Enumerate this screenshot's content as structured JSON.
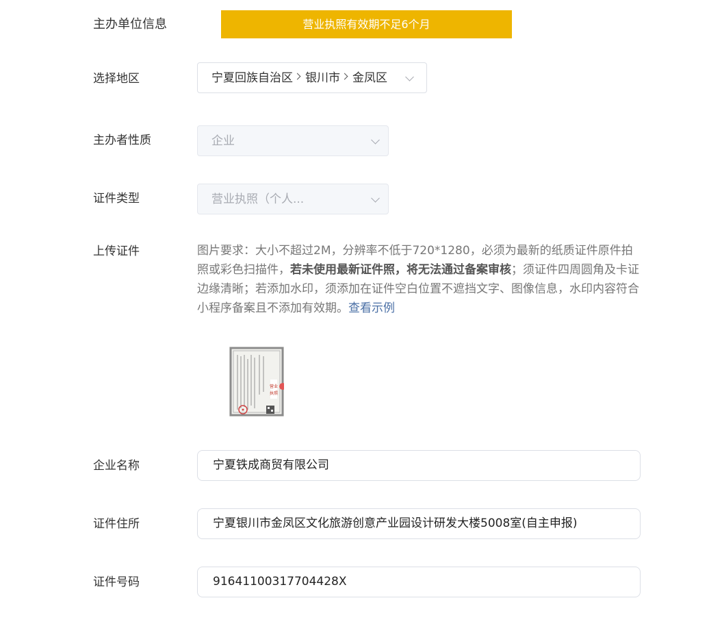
{
  "header": {
    "section_title": "主办单位信息",
    "warning_banner": "营业执照有效期不足6个月",
    "banner_color": "#EEB500"
  },
  "region": {
    "label": "选择地区",
    "parts": [
      "宁夏回族自治区",
      "银川市",
      "金凤区"
    ]
  },
  "organizer_type": {
    "label": "主办者性质",
    "value": "企业",
    "disabled": true
  },
  "certificate_type": {
    "label": "证件类型",
    "value": "营业执照（个人...",
    "disabled": true
  },
  "upload": {
    "label": "上传证件",
    "desc_part1": "图片要求：大小不超过2M，分辨率不低于720*1280，必须为最新的纸质证件原件拍照或彩色扫描件，",
    "desc_bold": "若未使用最新证件照，将无法通过备案审核",
    "desc_part2": "；须证件四周圆角及卡证边缘清晰；若添加水印，须添加在证件空白位置不遮挡文字、图像信息，水印内容符合小程序备案且不添加有效期。",
    "example_link": "查看示例",
    "thumbnail_stamp": "营业执照"
  },
  "company_name": {
    "label": "企业名称",
    "value": "宁夏铁成商贸有限公司"
  },
  "certificate_address": {
    "label": "证件住所",
    "value": "宁夏银川市金凤区文化旅游创意产业园设计研发大楼5008室(自主申报)"
  },
  "certificate_number": {
    "label": "证件号码",
    "value": "91641100317704428X"
  }
}
